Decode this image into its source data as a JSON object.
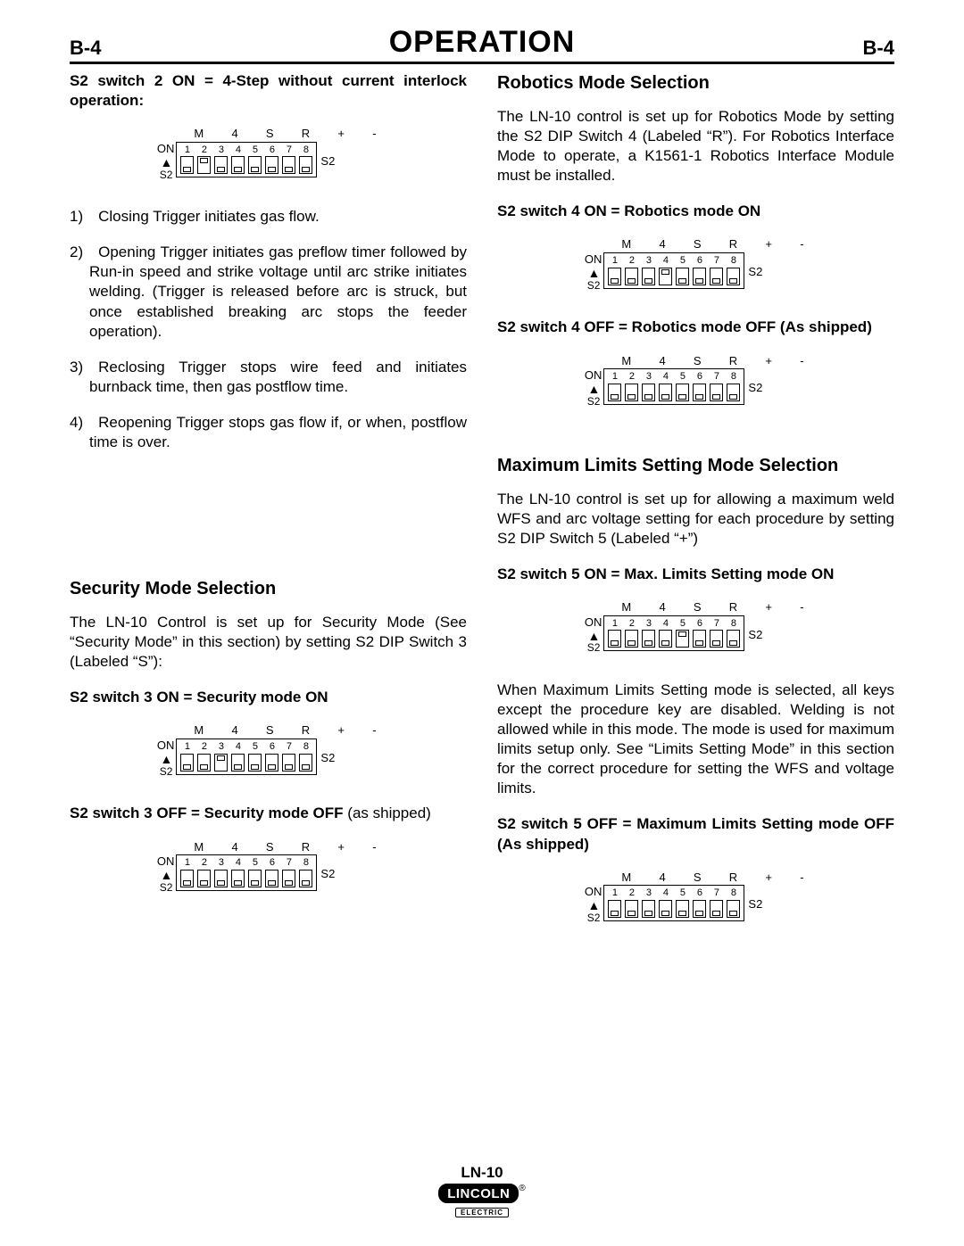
{
  "header": {
    "left": "B-4",
    "title": "OPERATION",
    "right": "B-4"
  },
  "left_col": {
    "s2_2_heading": "S2 switch 2 ON = 4-Step without current interlock operation:",
    "steps": [
      "1) Closing Trigger initiates gas flow.",
      "2) Opening Trigger initiates gas preflow timer followed by Run-in speed and strike voltage until arc strike initiates welding.  (Trigger is released before arc is struck, but once established breaking arc stops the feeder operation).",
      "3) Reclosing Trigger stops wire feed and initiates burnback time, then gas postflow time.",
      "4) Reopening Trigger stops gas flow if, or when, postflow time is over."
    ],
    "security_title": "Security Mode Selection",
    "security_body": "The LN-10 Control is set up for Security Mode (See “Security Mode” in this section) by setting S2 DIP Switch 3 (Labeled “S”):",
    "s2_3_on": "S2 switch 3 ON = Security mode ON",
    "s2_3_off_bold": "S2 switch 3 OFF = Security mode OFF",
    "s2_3_off_tail": " (as shipped)"
  },
  "right_col": {
    "robotics_title": "Robotics Mode Selection",
    "robotics_body": "The LN-10 control is set up for Robotics Mode by setting the S2 DIP Switch 4 (Labeled “R”).  For Robotics Interface Mode to operate, a K1561-1 Robotics Interface Module must be installed.",
    "s2_4_on": "S2 switch 4 ON = Robotics mode ON",
    "s2_4_off": "S2 switch 4 OFF = Robotics mode OFF (As shipped)",
    "max_title": "Maximum Limits Setting Mode Selection",
    "max_body": "The LN-10 control is set up for allowing a maximum weld WFS and arc voltage setting for each procedure by setting S2 DIP Switch 5 (Labeled “+”)",
    "s2_5_on": "S2 switch 5 ON = Max. Limits Setting mode ON",
    "max_note": "When Maximum Limits Setting mode is selected, all keys except the procedure key are disabled. Welding is not allowed while in this mode. The mode is used for maximum limits setup only. See “Limits Setting Mode” in this section for the correct procedure for setting the WFS and voltage limits.",
    "s2_5_off": "S2 switch 5 OFF = Maximum Limits Setting mode OFF (As shipped)"
  },
  "dip": {
    "top_labels": "M  4  S  R  +  -",
    "on": "ON",
    "s2": "S2",
    "nums": [
      "1",
      "2",
      "3",
      "4",
      "5",
      "6",
      "7",
      "8"
    ],
    "configs": {
      "sw2_on": [
        "down",
        "up",
        "down",
        "down",
        "down",
        "down",
        "down",
        "down"
      ],
      "sw3_on": [
        "down",
        "down",
        "up",
        "down",
        "down",
        "down",
        "down",
        "down"
      ],
      "sw3_off": [
        "down",
        "down",
        "down",
        "down",
        "down",
        "down",
        "down",
        "down"
      ],
      "sw4_on": [
        "down",
        "down",
        "down",
        "up",
        "down",
        "down",
        "down",
        "down"
      ],
      "sw4_off": [
        "down",
        "down",
        "down",
        "down",
        "down",
        "down",
        "down",
        "down"
      ],
      "sw5_on": [
        "down",
        "down",
        "down",
        "down",
        "up",
        "down",
        "down",
        "down"
      ],
      "sw5_off": [
        "down",
        "down",
        "down",
        "down",
        "down",
        "down",
        "down",
        "down"
      ]
    }
  },
  "footer": {
    "model": "LN-10",
    "brand": "LINCOLN",
    "sub": "ELECTRIC",
    "reg": "®"
  }
}
